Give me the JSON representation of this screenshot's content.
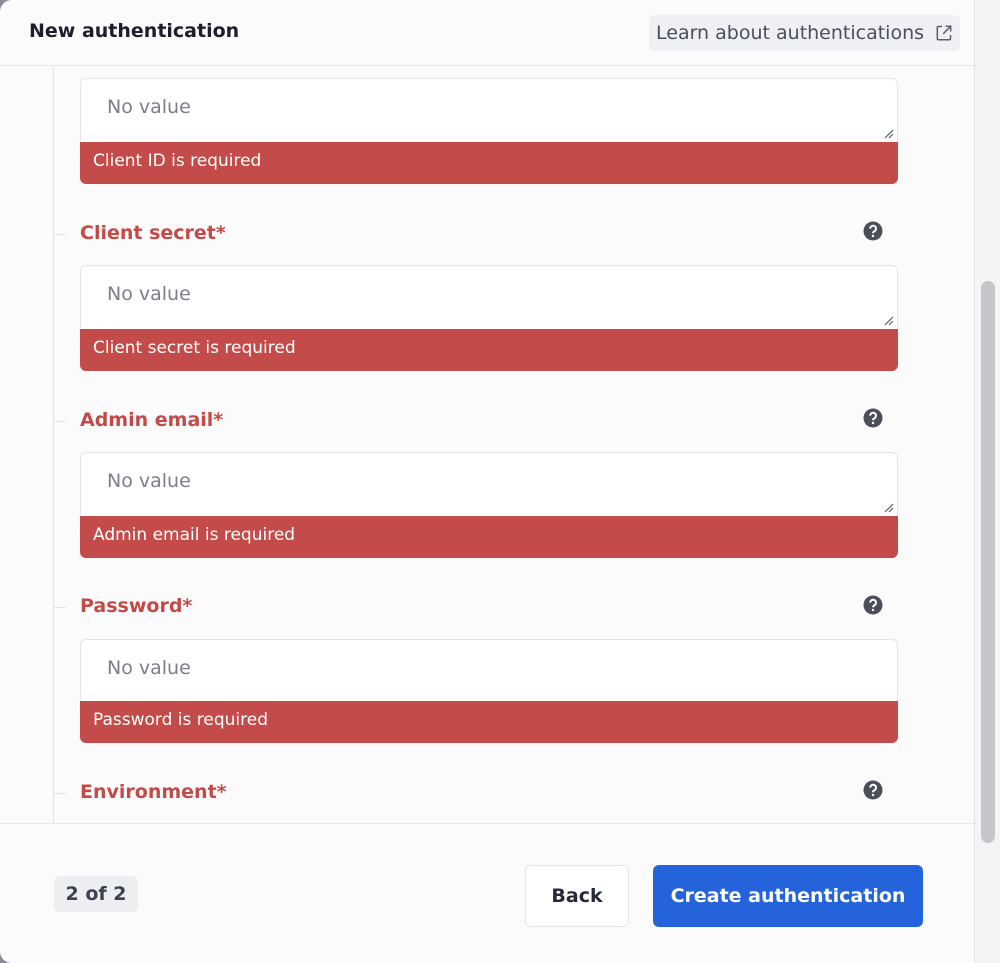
{
  "header": {
    "title": "New authentication",
    "learn_link": "Learn about authentications",
    "learn_link_icon": "external-link-icon"
  },
  "fields": [
    {
      "label": "",
      "placeholder": "No value",
      "error": "Client ID is required",
      "multiline": true
    },
    {
      "label": "Client secret*",
      "placeholder": "No value",
      "error": "Client secret is required",
      "multiline": true
    },
    {
      "label": "Admin email*",
      "placeholder": "No value",
      "error": "Admin email is required",
      "multiline": true
    },
    {
      "label": "Password*",
      "placeholder": "No value",
      "error": "Password is required",
      "multiline": false
    },
    {
      "label": "Environment*"
    }
  ],
  "footer": {
    "step": "2 of 2",
    "back_label": "Back",
    "create_label": "Create authentication"
  },
  "colors": {
    "error": "#c34c4a",
    "label_error": "#c44a48",
    "primary": "#2563da"
  }
}
